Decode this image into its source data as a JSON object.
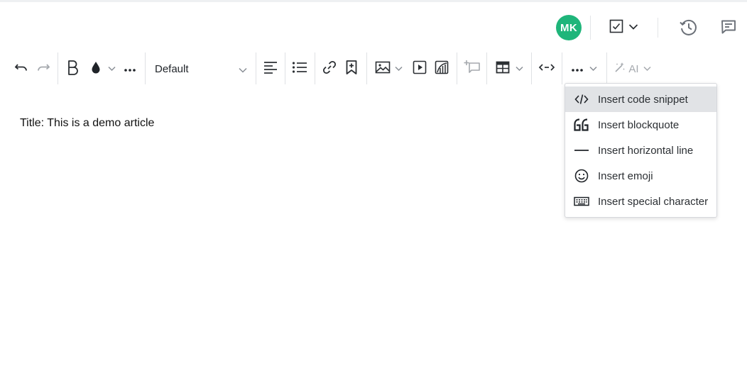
{
  "header": {
    "avatar_initials": "MK",
    "avatar_color": "#1fb57a",
    "icons": [
      "checkbox-icon",
      "history-icon",
      "comment-icon"
    ]
  },
  "toolbar": {
    "font_family_value": "Default",
    "ai_label": "AI"
  },
  "document": {
    "text": "Title: This is a demo article"
  },
  "more_menu": {
    "items": [
      {
        "label": "Insert code snippet",
        "icon": "code-icon",
        "active": true
      },
      {
        "label": "Insert blockquote",
        "icon": "blockquote-icon",
        "active": false
      },
      {
        "label": "Insert horizontal line",
        "icon": "horizontal-line-icon",
        "active": false
      },
      {
        "label": "Insert emoji",
        "icon": "emoji-icon",
        "active": false
      },
      {
        "label": "Insert special character",
        "icon": "keyboard-icon",
        "active": false
      }
    ]
  }
}
